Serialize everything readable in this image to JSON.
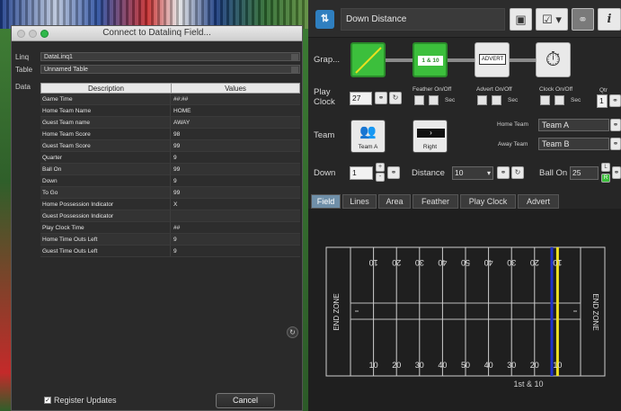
{
  "dialog": {
    "title": "Connect to Datalinq Field...",
    "labels": {
      "linq": "Linq",
      "table": "Table",
      "data": "Data"
    },
    "linq_value": "DataLinq1",
    "table_value": "Unnamed Table",
    "columns": {
      "description": "Description",
      "values": "Values"
    },
    "rows": [
      {
        "desc": "Game Time",
        "val": "##:##"
      },
      {
        "desc": "Home Team Name",
        "val": "HOME"
      },
      {
        "desc": "Guest Team name",
        "val": "AWAY"
      },
      {
        "desc": "Home Team Score",
        "val": "98"
      },
      {
        "desc": "Guest Team Score",
        "val": "99"
      },
      {
        "desc": "Quarter",
        "val": "9"
      },
      {
        "desc": "Ball On",
        "val": "99"
      },
      {
        "desc": "Down",
        "val": "9"
      },
      {
        "desc": "To Go",
        "val": "99"
      },
      {
        "desc": "Home Possession Indicator",
        "val": "X"
      },
      {
        "desc": "Guest Possession Indicator",
        "val": ""
      },
      {
        "desc": "Play Clock Time",
        "val": "##"
      },
      {
        "desc": "Home Time Outs Left",
        "val": "9"
      },
      {
        "desc": "Guest Time Outs Left",
        "val": "9"
      }
    ],
    "register_updates_label": "Register Updates",
    "register_updates_checked": true,
    "cancel_label": "Cancel"
  },
  "panel": {
    "title": "Down Distance",
    "graphic_label": "Grap...",
    "graphic_tiles": [
      {
        "kind": "diagonal",
        "label": ""
      },
      {
        "kind": "arrow",
        "label": "1 & 10"
      },
      {
        "kind": "advert",
        "label": "ADVERT"
      },
      {
        "kind": "timer",
        "label": ""
      }
    ],
    "play_clock_label_1": "Play",
    "play_clock_label_2": "Clock",
    "play_clock_value": "27",
    "feather_label": "Feather On/Off",
    "advert_label": "Advert On/Off",
    "clock_label": "Clock On/Off",
    "sec_label": "Sec",
    "qtr_label": "Qtr",
    "qtr_value": "1",
    "team_label": "Team",
    "team_a_label": "Team A",
    "right_label": "Right",
    "home_team_label": "Home Team",
    "home_team_value": "Team A",
    "away_team_label": "Away Team",
    "away_team_value": "Team B",
    "down_label": "Down",
    "down_value": "1",
    "distance_label": "Distance",
    "distance_value": "10",
    "ball_on_label": "Ball On",
    "ball_on_value": "25",
    "side_l": "L",
    "side_r": "R",
    "tabs": [
      "Field",
      "Lines",
      "Area",
      "Feather",
      "Play Clock",
      "Advert"
    ],
    "active_tab": 0,
    "field": {
      "end_zone_left": "END ZONE",
      "end_zone_right": "END ZONE",
      "yard_top": [
        "10",
        "20",
        "30",
        "40",
        "50",
        "40",
        "30",
        "20",
        "10"
      ],
      "yard_bottom": [
        "10",
        "20",
        "30",
        "40",
        "50",
        "40",
        "30",
        "20",
        "10"
      ],
      "status": "1st & 10",
      "line_of_scrimmage_color": "#2233cc",
      "first_down_color": "#f0e020"
    }
  }
}
